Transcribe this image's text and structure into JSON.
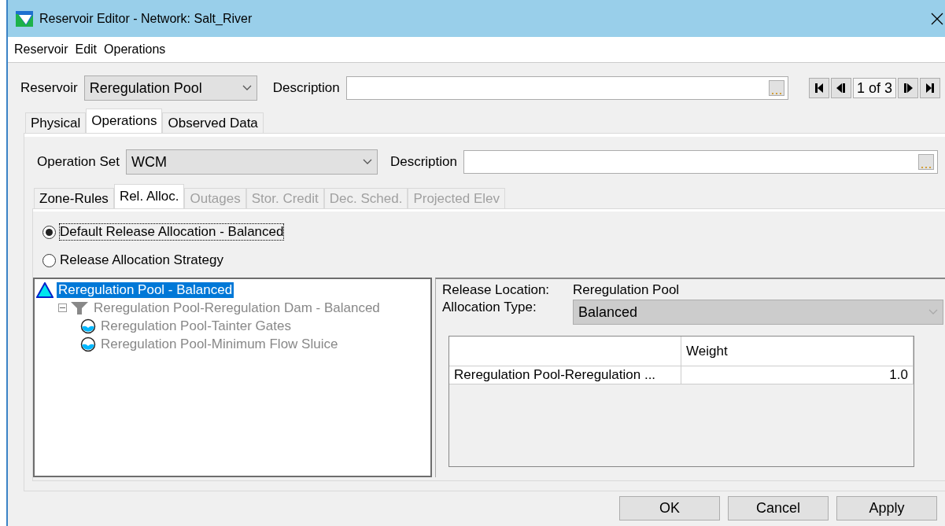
{
  "window": {
    "title": "Reservoir Editor - Network: Salt_River"
  },
  "menu": [
    "Reservoir",
    "Edit",
    "Operations"
  ],
  "reservoir": {
    "label": "Reservoir",
    "value": "Reregulation Pool",
    "description_label": "Description",
    "nav_position": "1 of 3"
  },
  "tabs": [
    {
      "label": "Physical",
      "selected": false
    },
    {
      "label": "Operations",
      "selected": true
    },
    {
      "label": "Observed Data",
      "selected": false
    }
  ],
  "operation_set": {
    "label": "Operation Set",
    "value": "WCM",
    "description_label": "Description"
  },
  "sub_tabs": [
    {
      "label": "Zone-Rules",
      "selected": false,
      "disabled": false
    },
    {
      "label": "Rel. Alloc.",
      "selected": true,
      "disabled": false
    },
    {
      "label": "Outages",
      "selected": false,
      "disabled": true
    },
    {
      "label": "Stor. Credit",
      "selected": false,
      "disabled": true
    },
    {
      "label": "Dec. Sched.",
      "selected": false,
      "disabled": true
    },
    {
      "label": "Projected Elev",
      "selected": false,
      "disabled": true
    }
  ],
  "options": [
    {
      "label": "Default Release Allocation - Balanced",
      "selected": true
    },
    {
      "label": "Release Allocation Strategy",
      "selected": false
    }
  ],
  "tree": [
    {
      "kind": "reservoir",
      "label": "Reregulation Pool - Balanced",
      "selected": true,
      "children": [
        {
          "kind": "dam",
          "label": "Reregulation Pool-Reregulation Dam - Balanced",
          "selected": false,
          "expanded": true,
          "children": [
            {
              "kind": "outlet",
              "label": "Reregulation Pool-Tainter Gates",
              "selected": false
            },
            {
              "kind": "outlet",
              "label": "Reregulation Pool-Minimum Flow Sluice",
              "selected": false
            }
          ]
        }
      ]
    }
  ],
  "details": {
    "location_label": "Release Location:",
    "location": "Reregulation Pool",
    "type_label": "Allocation Type:",
    "type": "Balanced"
  },
  "table": {
    "columns": [
      "Weight"
    ],
    "rows": [
      [
        "Reregulation Pool-Reregulation ...",
        "1.0"
      ]
    ]
  },
  "buttons": [
    "OK",
    "Cancel",
    "Apply"
  ]
}
